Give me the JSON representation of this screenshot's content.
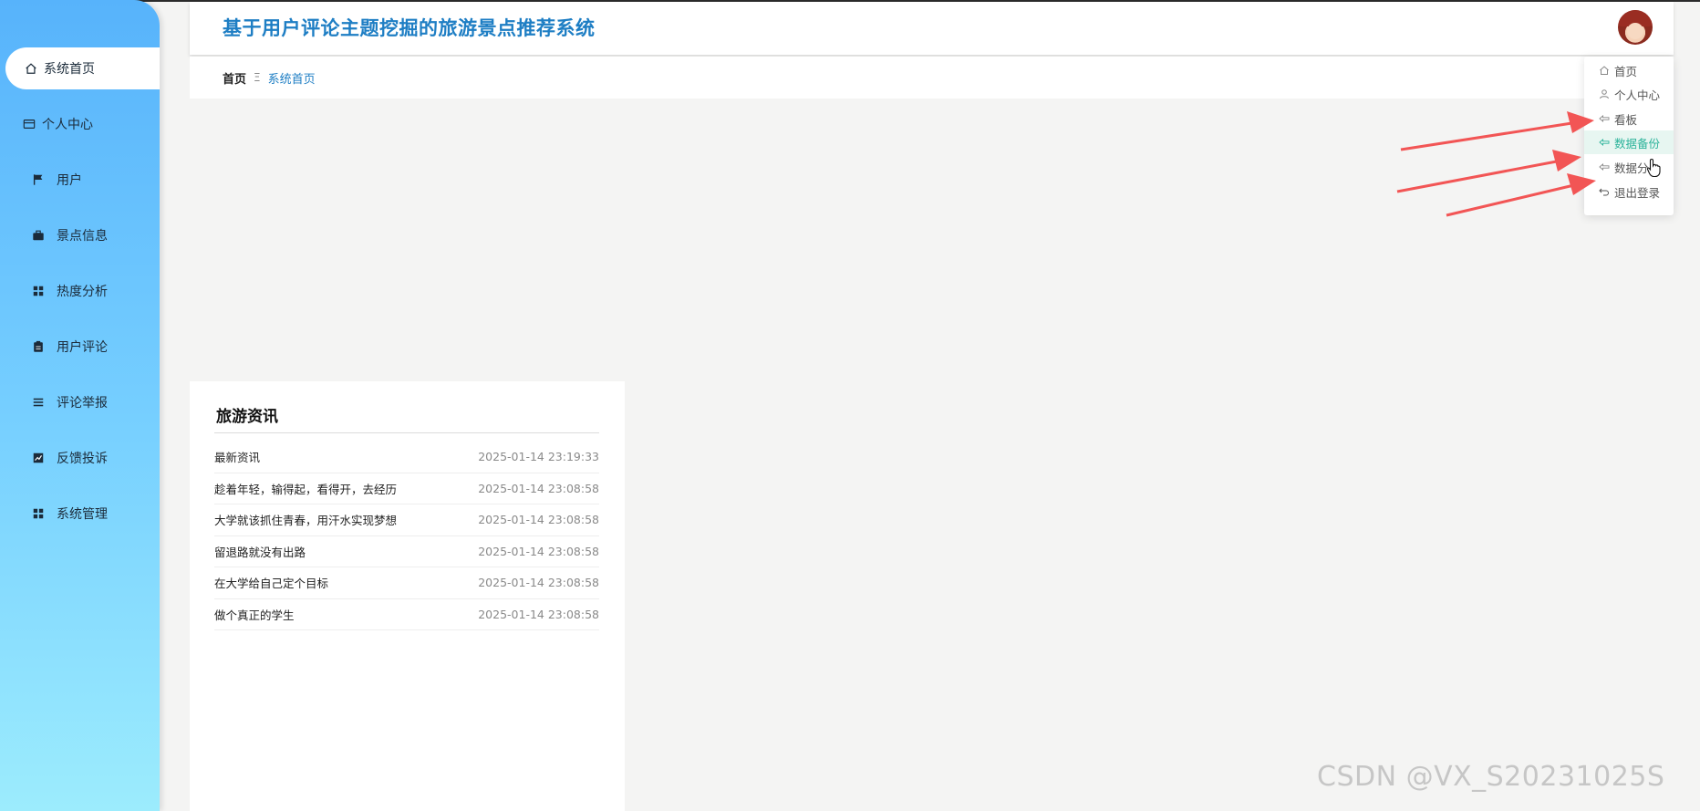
{
  "app": {
    "title": "基于用户评论主题挖掘的旅游景点推荐系统"
  },
  "sidebar": {
    "items": [
      {
        "label": "系统首页",
        "icon": "home-icon"
      },
      {
        "label": "个人中心",
        "icon": "card-icon"
      },
      {
        "label": "用户",
        "icon": "flag-icon"
      },
      {
        "label": "景点信息",
        "icon": "briefcase-icon"
      },
      {
        "label": "热度分析",
        "icon": "grid-icon"
      },
      {
        "label": "用户评论",
        "icon": "clipboard-icon"
      },
      {
        "label": "评论举报",
        "icon": "list-icon"
      },
      {
        "label": "反馈投诉",
        "icon": "chart-icon"
      },
      {
        "label": "系统管理",
        "icon": "grid-icon"
      }
    ]
  },
  "breadcrumb": {
    "home": "首页",
    "separator": "Ξ",
    "current": "系统首页"
  },
  "user_menu": {
    "items": [
      {
        "label": "首页",
        "icon": "home-icon"
      },
      {
        "label": "个人中心",
        "icon": "user-icon"
      },
      {
        "label": "看板",
        "icon": "arrow-left-icon"
      },
      {
        "label": "数据备份",
        "icon": "arrow-left-icon"
      },
      {
        "label": "数据分",
        "icon": "arrow-left-icon"
      },
      {
        "label": "退出登录",
        "icon": "logout-icon"
      }
    ],
    "highlighted": "数据备份",
    "highlight_color": "#2bb39a"
  },
  "news": {
    "title": "旅游资讯",
    "items": [
      {
        "title": "最新资讯",
        "date": "2025-01-14 23:19:33"
      },
      {
        "title": "趁着年轻，输得起，看得开，去经历",
        "date": "2025-01-14 23:08:58"
      },
      {
        "title": "大学就该抓住青春，用汗水实现梦想",
        "date": "2025-01-14 23:08:58"
      },
      {
        "title": "留退路就没有出路",
        "date": "2025-01-14 23:08:58"
      },
      {
        "title": "在大学给自己定个目标",
        "date": "2025-01-14 23:08:58"
      },
      {
        "title": "做个真正的学生",
        "date": "2025-01-14 23:08:58"
      }
    ]
  },
  "watermark": "CSDN @VX_S20231025S",
  "colors": {
    "accent": "#1e7ec4",
    "sidebar_top": "#57b3fb",
    "sidebar_bottom": "#9cecfd",
    "annotation_arrow": "#f25555"
  }
}
